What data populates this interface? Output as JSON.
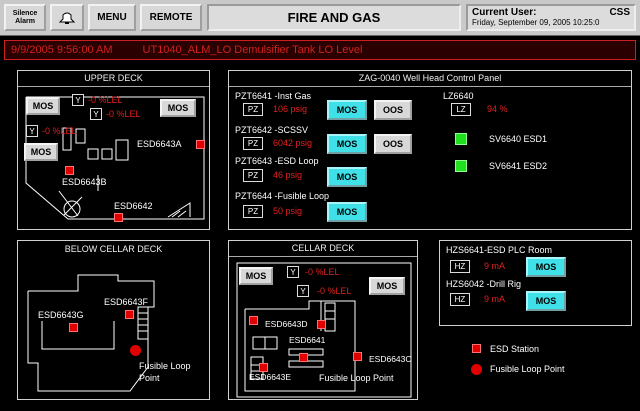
{
  "toolbar": {
    "silence_alarm_label": "Silence Alarm",
    "menu_label": "MENU",
    "remote_label": "REMOTE",
    "screen_title": "FIRE AND GAS",
    "current_user_label": "Current User:",
    "current_user": "CSS",
    "datetime": "Friday, September 09, 2005 10:25:0"
  },
  "alarm": {
    "timestamp": "9/9/2005 9:56:00 AM",
    "message": "UT1040_ALM_LO Demulsifier Tank LO Level",
    "color": "#d02020"
  },
  "upper_deck": {
    "title": "UPPER DECK",
    "mos_label": "MOS",
    "y_label": "Y",
    "readings": [
      "-0 %LEL",
      "-0 %LEL",
      "-0 %LEL"
    ],
    "esd_a": "ESD6643A",
    "esd_b": "ESD6643B",
    "esd_c": "ESD6642"
  },
  "wellhead": {
    "title": "ZAG-0040 Well Head Control Panel",
    "rows": [
      {
        "name": "PZT6641 -Inst Gas",
        "tag": "PZ",
        "value": "106 psig",
        "mos": "MOS",
        "oos": "OOS"
      },
      {
        "name": "PZT6642 -SCSSV",
        "tag": "PZ",
        "value": "6042 psig",
        "mos": "MOS",
        "oos": "OOS"
      },
      {
        "name": "PZT6643 -ESD Loop",
        "tag": "PZ",
        "value": "46 psig",
        "mos": "MOS"
      },
      {
        "name": "PZT6644 -Fusible Loop",
        "tag": "PZ",
        "value": "50 psig",
        "mos": "MOS"
      }
    ],
    "lz_name": "LZ6640",
    "lz_tag": "LZ",
    "lz_value": "94 %",
    "sv1": "SV6640 ESD1",
    "sv2": "SV6641 ESD2"
  },
  "below_cellar": {
    "title": "BELOW CELLAR DECK",
    "esd_f": "ESD6643F",
    "esd_g": "ESD6643G",
    "fusible": "Fusible Loop",
    "point": "Point"
  },
  "cellar": {
    "title": "CELLAR DECK",
    "mos_label": "MOS",
    "y_label": "Y",
    "readings": [
      "-0 %LEL",
      "-0 %LEL"
    ],
    "esd_d": "ESD6643D",
    "esd_6641": "ESD6641",
    "esd_c": "ESD6643C",
    "esd_e": "ESD6643E",
    "fusible": "Fusible Loop Point"
  },
  "hzs": {
    "row1_name": "HZS6641-ESD PLC Room",
    "row1_tag": "HZ",
    "row1_value": "9 mA",
    "row2_name": "HZS6042 -Drill Rig",
    "row2_tag": "HZ",
    "row2_value": "9 mA",
    "mos_label": "MOS"
  },
  "legend": {
    "esd_station": "ESD Station",
    "fusible_loop_point": "Fusible Loop Point"
  },
  "colors": {
    "background": "#000000",
    "alarm_red": "#e02020",
    "mos_cyan": "#40e0e8",
    "status_green": "#20e020"
  }
}
